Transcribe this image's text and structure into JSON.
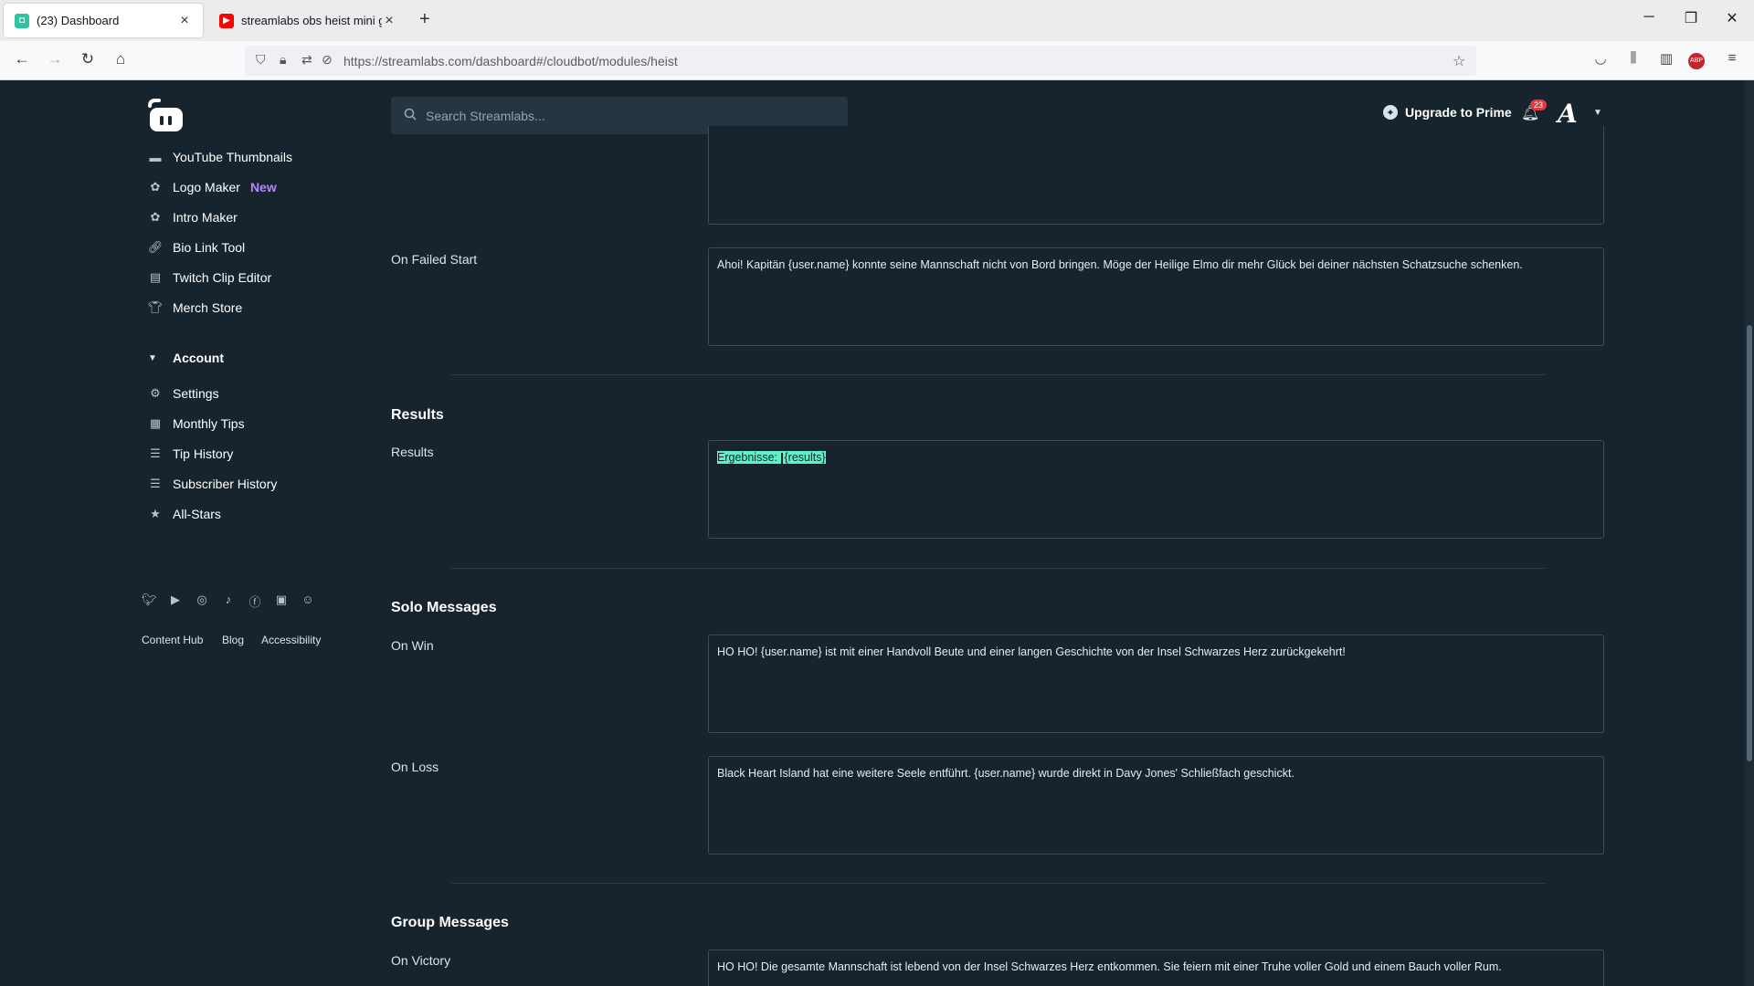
{
  "browser": {
    "tabs": [
      {
        "title": "(23) Dashboard"
      },
      {
        "title": "streamlabs obs heist mini game"
      }
    ],
    "url": "https://streamlabs.com/dashboard#/cloudbot/modules/heist",
    "new_tab_glyph": "+"
  },
  "header": {
    "search_placeholder": "Search Streamlabs...",
    "upgrade_label": "Upgrade to Prime",
    "notification_count": "23"
  },
  "sidebar": {
    "tools": [
      {
        "label": "YouTube Thumbnails",
        "icon": "thumbnail-icon"
      },
      {
        "label": "Logo Maker",
        "icon": "logo-maker-icon",
        "badge": "New"
      },
      {
        "label": "Intro Maker",
        "icon": "intro-maker-icon"
      },
      {
        "label": "Bio Link Tool",
        "icon": "link-icon"
      },
      {
        "label": "Twitch Clip Editor",
        "icon": "clip-editor-icon"
      },
      {
        "label": "Merch Store",
        "icon": "shirt-icon"
      }
    ],
    "account_heading": "Account",
    "account_items": [
      {
        "label": "Settings",
        "icon": "gear-icon"
      },
      {
        "label": "Monthly Tips",
        "icon": "calendar-icon"
      },
      {
        "label": "Tip History",
        "icon": "list-icon"
      },
      {
        "label": "Subscriber History",
        "icon": "list-icon"
      },
      {
        "label": "All-Stars",
        "icon": "star-icon"
      }
    ],
    "social_icons": [
      "twitter-icon",
      "youtube-icon",
      "instagram-icon",
      "tiktok-icon",
      "facebook-icon",
      "linkedin-icon",
      "discord-icon"
    ],
    "footer_links": [
      "Content Hub",
      "Blog",
      "Accessibility"
    ]
  },
  "main": {
    "top_field_text": "",
    "on_failed_start": {
      "label": "On Failed Start",
      "text": "Ahoi! Kapitän {user.name} konnte seine Mannschaft nicht von Bord bringen. Möge der Heilige Elmo dir mehr Glück bei deiner nächsten Schatzsuche schenken."
    },
    "results_section": {
      "heading": "Results",
      "label": "Results",
      "text_before_cursor": "Ergebnisse: ",
      "text_after_cursor": "{results}"
    },
    "solo_section": {
      "heading": "Solo Messages",
      "on_win_label": "On Win",
      "on_win_text": "HO HO! {user.name} ist mit einer Handvoll Beute und einer langen Geschichte von der Insel Schwarzes Herz zurückgekehrt!",
      "on_loss_label": "On Loss",
      "on_loss_text": "Black Heart Island hat eine weitere Seele entführt. {user.name} wurde direkt in Davy Jones' Schließfach geschickt."
    },
    "group_section": {
      "heading": "Group Messages",
      "on_victory_label": "On Victory",
      "on_victory_text": "HO HO! Die gesamte Mannschaft ist lebend von der Insel Schwarzes Herz entkommen. Sie feiern mit einer Truhe voller Gold und einem Bauch voller Rum."
    }
  },
  "colors": {
    "background": "#17242d",
    "accent_new": "#b687ff",
    "selection": "#5ef0c7",
    "badge": "#e0393e"
  }
}
